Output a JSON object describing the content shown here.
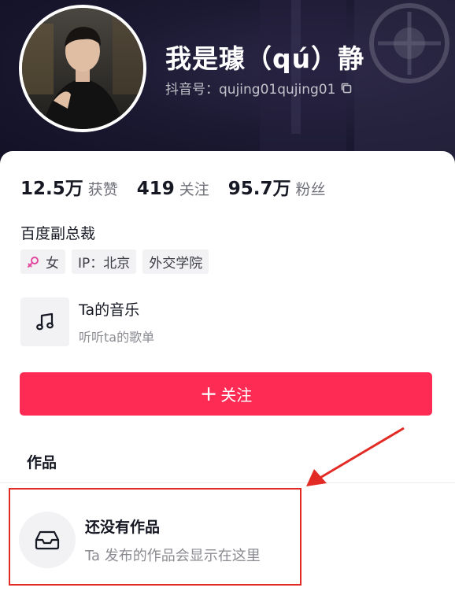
{
  "profile": {
    "name": "我是璩（qú）静",
    "douyin_id": "抖音号：qujing01qujing01",
    "avatar_icon": "profile-photo"
  },
  "stats": [
    {
      "value": "12.5万",
      "label": "获赞"
    },
    {
      "value": "419",
      "label": "关注"
    },
    {
      "value": "95.7万",
      "label": "粉丝"
    }
  ],
  "bio": "百度副总裁",
  "tags": {
    "gender": "女",
    "ip": "IP：北京",
    "school": "外交学院"
  },
  "music": {
    "title": "Ta的音乐",
    "subtitle": "听听ta的歌单",
    "icon": "music-note-icon"
  },
  "follow_button": {
    "plus": "+",
    "label": "关注"
  },
  "tabs": {
    "works": "作品"
  },
  "empty_state": {
    "title": "还没有作品",
    "subtitle": "Ta 发布的作品会显示在这里",
    "icon": "inbox-icon"
  },
  "colors": {
    "accent": "#fe2c55",
    "annotation": "#e22b25",
    "header_bg": "#1c1a33"
  }
}
